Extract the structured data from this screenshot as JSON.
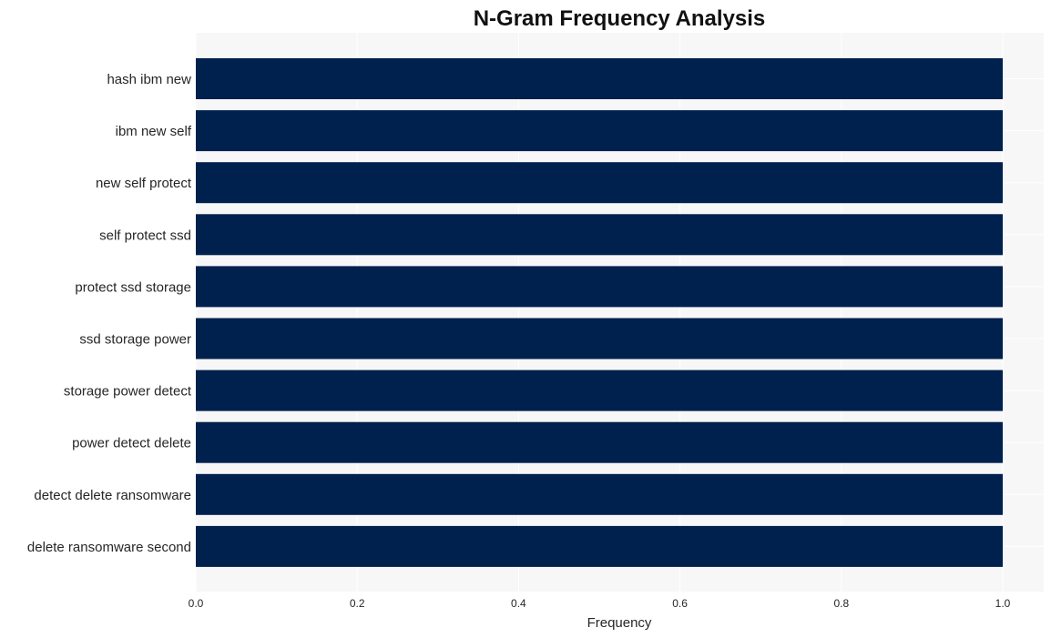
{
  "chart_data": {
    "type": "bar",
    "orientation": "horizontal",
    "title": "N-Gram Frequency Analysis",
    "xlabel": "Frequency",
    "ylabel": "",
    "categories": [
      "hash ibm new",
      "ibm new self",
      "new self protect",
      "self protect ssd",
      "protect ssd storage",
      "ssd storage power",
      "storage power detect",
      "power detect delete",
      "detect delete ransomware",
      "delete ransomware second"
    ],
    "values": [
      1,
      1,
      1,
      1,
      1,
      1,
      1,
      1,
      1,
      1
    ],
    "xlim": [
      0,
      1.05
    ],
    "xticks": [
      0.0,
      0.2,
      0.4,
      0.6,
      0.8,
      1.0
    ],
    "xtick_labels": [
      "0.0",
      "0.2",
      "0.4",
      "0.6",
      "0.8",
      "1.0"
    ],
    "grid": true,
    "legend": "none",
    "colors": {
      "bar": "#00204e",
      "plot_background": "#f7f7f7",
      "grid": "#ffffff"
    }
  }
}
